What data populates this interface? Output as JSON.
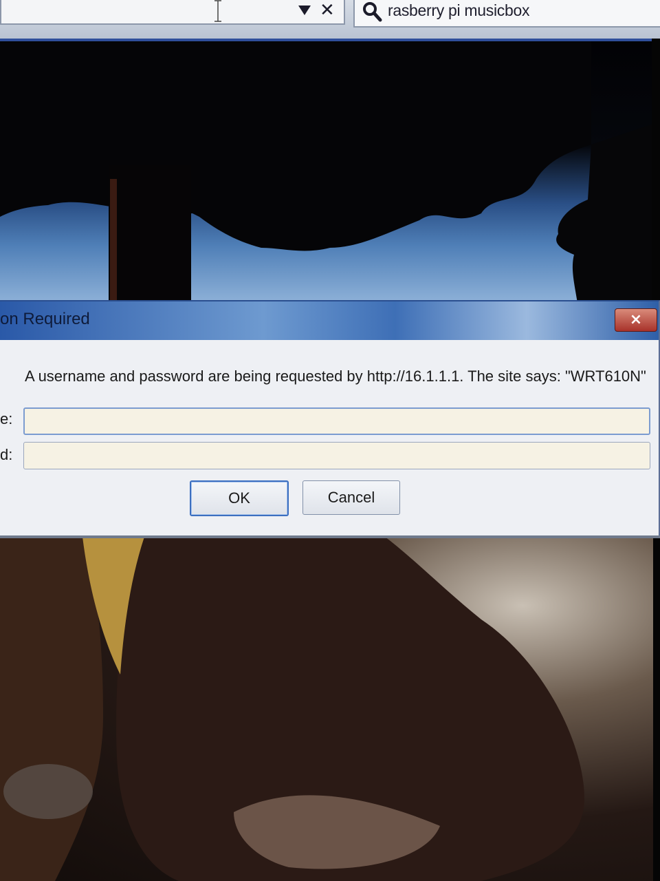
{
  "browser": {
    "search_query": "rasberry pi musicbox",
    "icons": {
      "dropdown": "chevron-down-icon",
      "clear": "close-icon",
      "search": "search-icon"
    }
  },
  "dialog": {
    "title": "on Required",
    "message": "A username and password are being requested by http://16.1.1.1. The site says: \"WRT610N\"",
    "username_label": "e:",
    "password_label": "d:",
    "username_value": "",
    "password_value": "",
    "ok_label": "OK",
    "cancel_label": "Cancel",
    "close_glyph": "×"
  },
  "colors": {
    "titlebar": "#3e6fb6",
    "close_button": "#a8322a",
    "input_bg": "#f6f2e4",
    "default_button_border": "#3c6fc0"
  }
}
